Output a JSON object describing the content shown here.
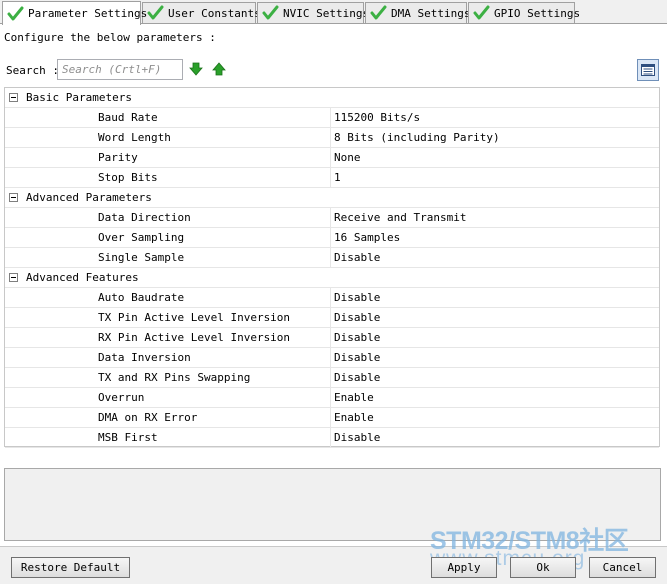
{
  "tabs": [
    {
      "label": "Parameter Settings",
      "active": true
    },
    {
      "label": "User Constants",
      "active": false
    },
    {
      "label": "NVIC Settings",
      "active": false
    },
    {
      "label": "DMA Settings",
      "active": false
    },
    {
      "label": "GPIO Settings",
      "active": false
    }
  ],
  "description": "Configure the below parameters :",
  "search": {
    "label": "Search :",
    "placeholder": "Search (Crtl+F)"
  },
  "groups": [
    {
      "title": "Basic Parameters",
      "params": [
        {
          "name": "Baud Rate",
          "value": "115200 Bits/s"
        },
        {
          "name": "Word Length",
          "value": "8 Bits (including Parity)"
        },
        {
          "name": "Parity",
          "value": "None"
        },
        {
          "name": "Stop Bits",
          "value": "1"
        }
      ]
    },
    {
      "title": "Advanced Parameters",
      "params": [
        {
          "name": "Data Direction",
          "value": "Receive and Transmit"
        },
        {
          "name": "Over Sampling",
          "value": "16 Samples"
        },
        {
          "name": "Single Sample",
          "value": "Disable"
        }
      ]
    },
    {
      "title": "Advanced Features",
      "params": [
        {
          "name": "Auto Baudrate",
          "value": "Disable"
        },
        {
          "name": "TX Pin Active Level Inversion",
          "value": "Disable"
        },
        {
          "name": "RX Pin Active Level Inversion",
          "value": "Disable"
        },
        {
          "name": "Data Inversion",
          "value": "Disable"
        },
        {
          "name": "TX and RX Pins Swapping",
          "value": "Disable"
        },
        {
          "name": "Overrun",
          "value": "Enable"
        },
        {
          "name": "DMA on RX Error",
          "value": "Enable"
        },
        {
          "name": "MSB First",
          "value": "Disable"
        }
      ]
    }
  ],
  "buttons": {
    "restore": "Restore Default",
    "apply": "Apply",
    "ok": "Ok",
    "cancel": "Cancel"
  },
  "watermark": {
    "line1": "STM32/STM8社区",
    "line2": "www.stmcu.org"
  },
  "colors": {
    "check_green": "#3cb043",
    "arrow_green": "#2aa02a",
    "watermark": "#7fb4e0"
  }
}
